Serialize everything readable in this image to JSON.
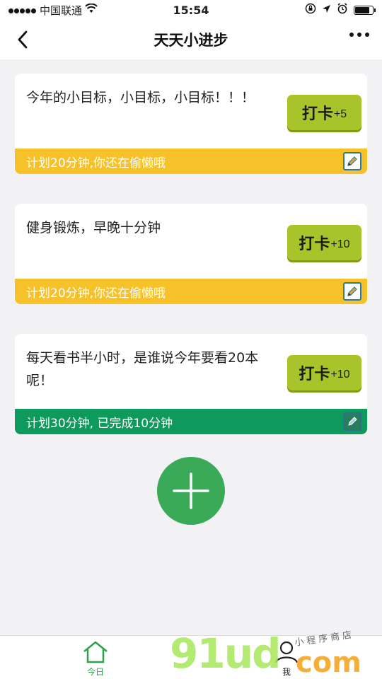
{
  "status_bar": {
    "carrier": "中国联通",
    "time": "15:54",
    "icons": [
      "signal-dots",
      "wifi-icon",
      "rotation-lock-icon",
      "location-icon",
      "alarm-icon",
      "battery-icon"
    ]
  },
  "nav": {
    "title": "天天小进步",
    "icons": [
      "back-chevron-icon",
      "more-dots-icon"
    ]
  },
  "cards": [
    {
      "title": "今年的小目标，小目标，小目标！！！",
      "checkin_label": "打卡",
      "checkin_points": "+5",
      "footer_text": "计划20分钟,你还在偷懒哦",
      "footer_color": "#f7c12a"
    },
    {
      "title": "健身锻炼，早晚十分钟",
      "checkin_label": "打卡",
      "checkin_points": "+10",
      "footer_text": "计划20分钟,你还在偷懒哦",
      "footer_color": "#f7c12a"
    },
    {
      "title": "每天看书半小时，是谁说今年要看20本呢！",
      "checkin_label": "打卡",
      "checkin_points": "+10",
      "footer_text": "计划30分钟, 已完成10分钟",
      "footer_color": "#0e9a5c"
    }
  ],
  "tabs": [
    {
      "label": "今日",
      "icon": "home-icon",
      "active": true
    },
    {
      "label": "我",
      "icon": "user-icon",
      "active": false
    }
  ],
  "watermark": {
    "brand": "91ud",
    "suffix": "com",
    "tagline": "小程序商店"
  },
  "colors": {
    "accent_green": "#3aaa58",
    "checkin_btn": "#a8c42a",
    "warning_yellow": "#f7c12a",
    "progress_green": "#0e9a5c"
  }
}
